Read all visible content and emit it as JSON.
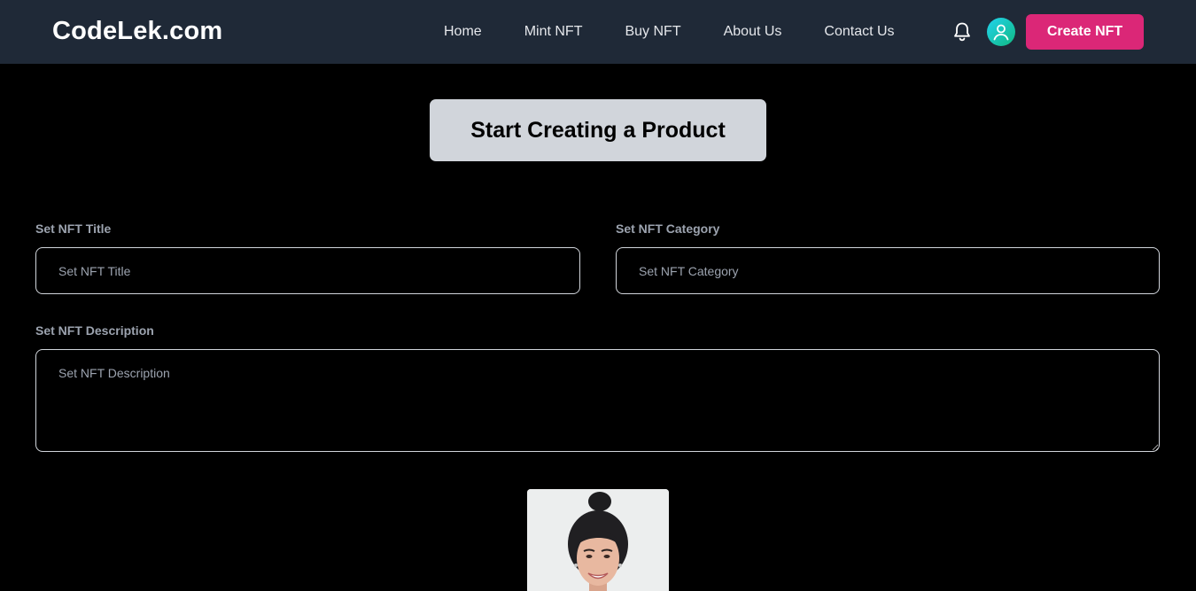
{
  "nav": {
    "brand": "CodeLek.com",
    "links": [
      "Home",
      "Mint NFT",
      "Buy NFT",
      "About Us",
      "Contact Us"
    ],
    "create_label": "Create NFT"
  },
  "hero": {
    "button_label": "Start Creating a Product"
  },
  "form": {
    "title_label": "Set NFT Title",
    "title_placeholder": "Set NFT Title",
    "title_value": "",
    "category_label": "Set NFT Category",
    "category_placeholder": "Set NFT Category",
    "category_value": "",
    "description_label": "Set NFT Description",
    "description_placeholder": "Set NFT Description",
    "description_value": ""
  },
  "icons": {
    "bell": "bell-icon",
    "avatar": "user-avatar-icon"
  },
  "colors": {
    "navbar_bg": "#1f2937",
    "accent": "#db2777",
    "hero_button_bg": "#d1d5db",
    "page_bg": "#000000"
  }
}
